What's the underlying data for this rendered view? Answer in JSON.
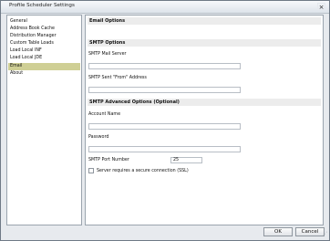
{
  "window": {
    "title": "Profile Scheduler Settings",
    "close_symbol": "×"
  },
  "sidebar": {
    "items": [
      {
        "label": "General",
        "selected": false
      },
      {
        "label": "Address Book Cache",
        "selected": false
      },
      {
        "label": "Distribution Manager",
        "selected": false
      },
      {
        "label": "Custom Table Loads",
        "selected": false
      },
      {
        "label": "Load Local INF",
        "selected": false
      },
      {
        "label": "Load Local JDE",
        "selected": false
      },
      {
        "label": "Email",
        "selected": true
      },
      {
        "label": "About",
        "selected": false
      }
    ]
  },
  "email_options": {
    "header": "Email Options",
    "smtp_options": {
      "header": "SMTP Options",
      "mail_server_label": "SMTP Mail Server",
      "mail_server_value": "",
      "sent_from_label": "SMTP Sent \"From\" Address",
      "sent_from_value": ""
    },
    "advanced_options": {
      "header": "SMTP Advanced Options (Optional)",
      "account_name_label": "Account Name",
      "account_name_value": "",
      "password_label": "Password",
      "password_value": "",
      "port_label": "SMTP Port Number",
      "port_value": "25",
      "secure_connection_label": "Server requires a secure connection (SSL)",
      "secure_connection_checked": false
    }
  },
  "buttons": {
    "ok": "OK",
    "cancel": "Cancel"
  },
  "icons": {
    "close": "close-icon",
    "checkbox": "checkbox-icon",
    "resize": "resize-grip-icon"
  },
  "colors": {
    "selected_item": "#cfcf95",
    "section_header": "#ececec",
    "border": "#9aa4ae"
  }
}
